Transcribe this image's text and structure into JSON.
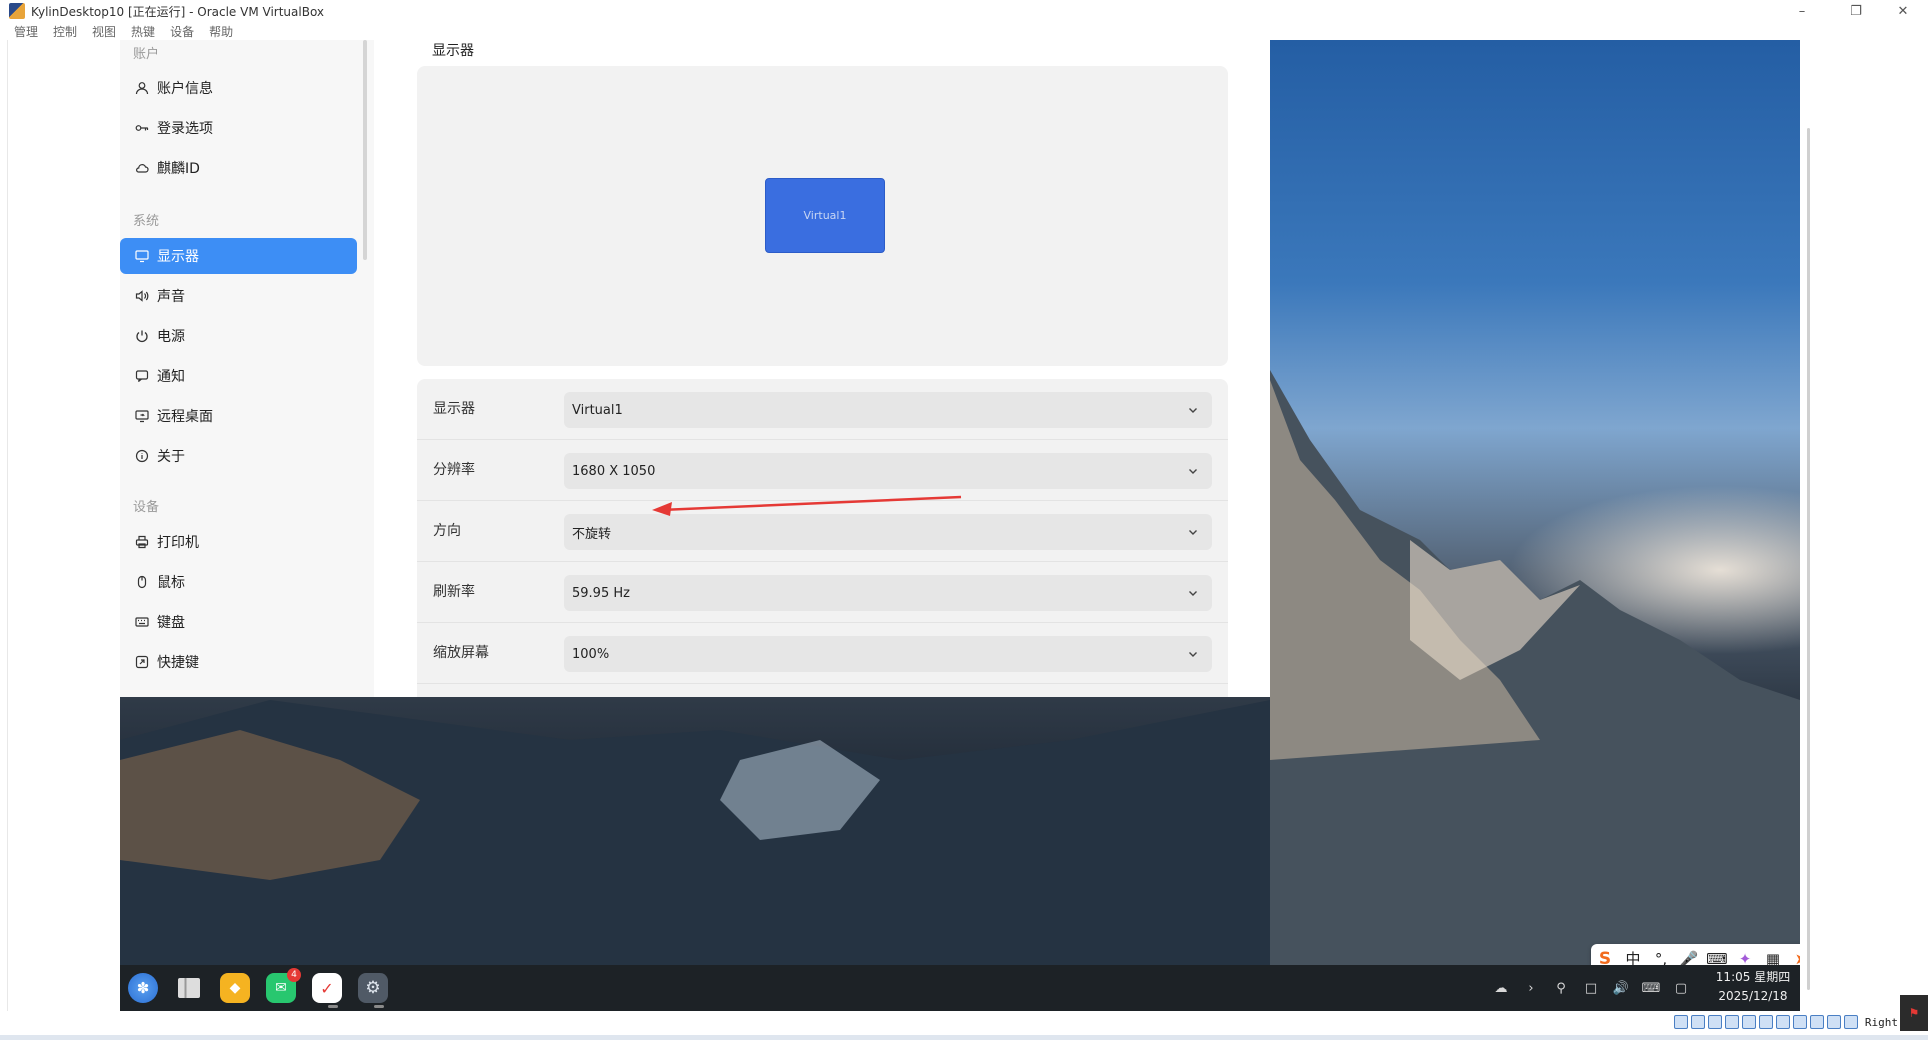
{
  "host": {
    "title": "KylinDesktop10 [正在运行] - Oracle VM VirtualBox",
    "menu": [
      "管理",
      "控制",
      "视图",
      "热键",
      "设备",
      "帮助"
    ],
    "host_key": "Right"
  },
  "sidebar": {
    "groups": {
      "account": "账户",
      "system": "系统",
      "devices": "设备"
    },
    "items": [
      {
        "label": "账户信息",
        "icon": "user-icon"
      },
      {
        "label": "登录选项",
        "icon": "key-icon"
      },
      {
        "label": "麒麟ID",
        "icon": "cloud-icon"
      },
      {
        "label": "显示器",
        "icon": "monitor-icon",
        "active": true
      },
      {
        "label": "声音",
        "icon": "speaker-icon"
      },
      {
        "label": "电源",
        "icon": "power-icon"
      },
      {
        "label": "通知",
        "icon": "notification-icon"
      },
      {
        "label": "远程桌面",
        "icon": "remote-desktop-icon"
      },
      {
        "label": "关于",
        "icon": "info-icon"
      },
      {
        "label": "打印机",
        "icon": "printer-icon"
      },
      {
        "label": "鼠标",
        "icon": "mouse-icon"
      },
      {
        "label": "键盘",
        "icon": "keyboard-icon"
      },
      {
        "label": "快捷键",
        "icon": "shortcut-icon"
      }
    ]
  },
  "display": {
    "heading": "显示器",
    "preview_monitor": "Virtual1",
    "rows": [
      {
        "label": "显示器",
        "value": "Virtual1"
      },
      {
        "label": "分辨率",
        "value": "1680 X 1050"
      },
      {
        "label": "方向",
        "value": "不旋转"
      },
      {
        "label": "刷新率",
        "value": "59.95 Hz"
      },
      {
        "label": "缩放屏幕",
        "value": "100%"
      }
    ]
  },
  "taskbar": {
    "apps": [
      "start-menu-icon",
      "file-manager-icon",
      "app-store-icon",
      "messenger-icon",
      "document-app-icon",
      "settings-app-icon"
    ],
    "messenger_badge": "4",
    "clock_time": "11:05 星期四",
    "clock_date": "2025/12/18"
  },
  "ime": {
    "mode": "中"
  },
  "colors": {
    "accent": "#3d8ef5",
    "monitor_block": "#3a6ee0",
    "annotation_arrow": "#e53935",
    "taskbar": "#1d2226"
  }
}
